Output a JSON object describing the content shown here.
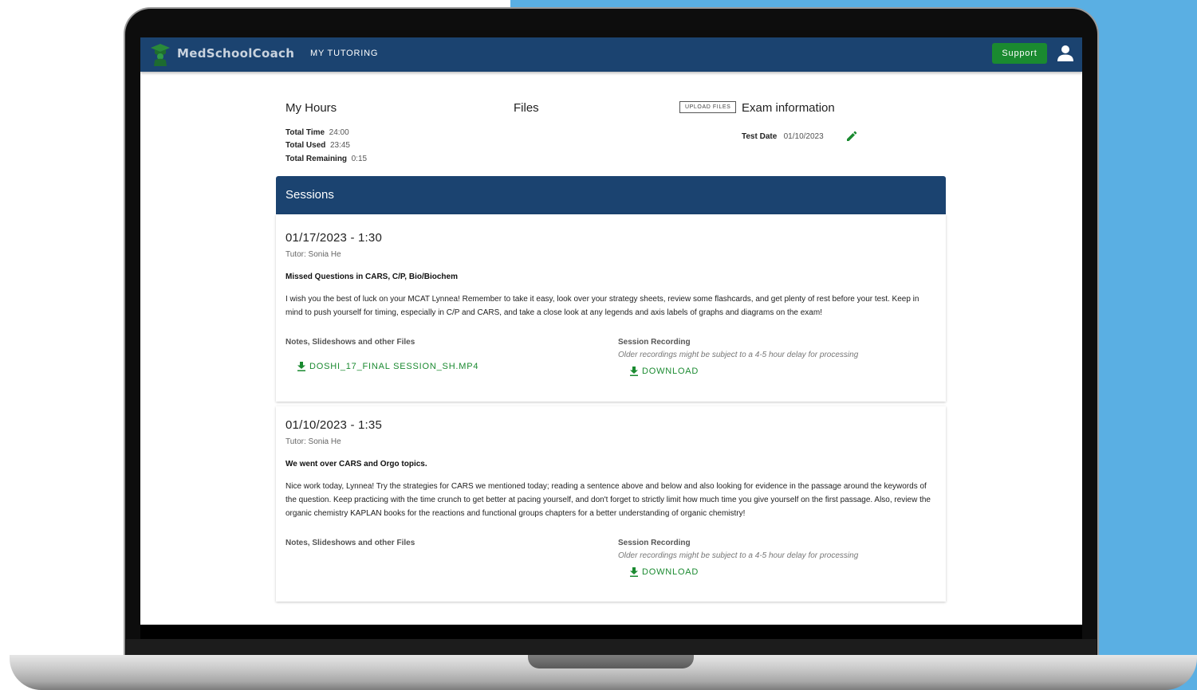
{
  "colors": {
    "nav_bg": "#1b4370",
    "accent_green": "#1a8a30",
    "background_blue": "#5aafe3"
  },
  "header": {
    "brand": "MedSchoolCoach",
    "nav_item": "MY TUTORING",
    "support_label": "Support",
    "icons": [
      "graduation-logo-icon",
      "user-icon"
    ]
  },
  "hours": {
    "title": "My Hours",
    "total_time_label": "Total Time",
    "total_time": "24:00",
    "total_used_label": "Total Used",
    "total_used": "23:45",
    "total_remaining_label": "Total Remaining",
    "total_remaining": "0:15"
  },
  "files": {
    "title": "Files",
    "upload_label": "UPLOAD FILES"
  },
  "exam": {
    "title": "Exam information",
    "test_date_label": "Test Date",
    "test_date": "01/10/2023",
    "edit_icon": "pencil-icon"
  },
  "sessions": {
    "title": "Sessions",
    "items": [
      {
        "date": "01/17/2023 - 1:30",
        "tutor": "Tutor: Sonia He",
        "topic": "Missed Questions in CARS, C/P, Bio/Biochem",
        "notes": "I wish you the best of luck on your MCAT Lynnea! Remember to take it easy, look over your strategy sheets, review some flashcards, and get plenty of rest before your test. Keep in mind to push yourself for timing, especially in C/P and CARS, and take a close look at any legends and axis labels of graphs and diagrams on the exam!",
        "files_label": "Notes, Slideshows and other Files",
        "file_name": "DOSHI_17_FINAL SESSION_SH.MP4",
        "recording_label": "Session Recording",
        "recording_note": "Older recordings might be subject to a 4-5 hour delay for processing",
        "download_label": "DOWNLOAD"
      },
      {
        "date": "01/10/2023 - 1:35",
        "tutor": "Tutor: Sonia He",
        "topic": "We went over CARS and Orgo topics.",
        "notes": "Nice work today, Lynnea! Try the strategies for CARS we mentioned today; reading a sentence above and below and also looking for evidence in the passage around the keywords of the question. Keep practicing with the time crunch to get better at pacing yourself, and don't forget to strictly limit how much time you give yourself on the first passage. Also, review the organic chemistry KAPLAN books for the reactions and functional groups chapters for a better understanding of organic chemistry!",
        "files_label": "Notes, Slideshows and other Files",
        "recording_label": "Session Recording",
        "recording_note": "Older recordings might be subject to a 4-5 hour delay for processing",
        "download_label": "DOWNLOAD"
      }
    ]
  }
}
